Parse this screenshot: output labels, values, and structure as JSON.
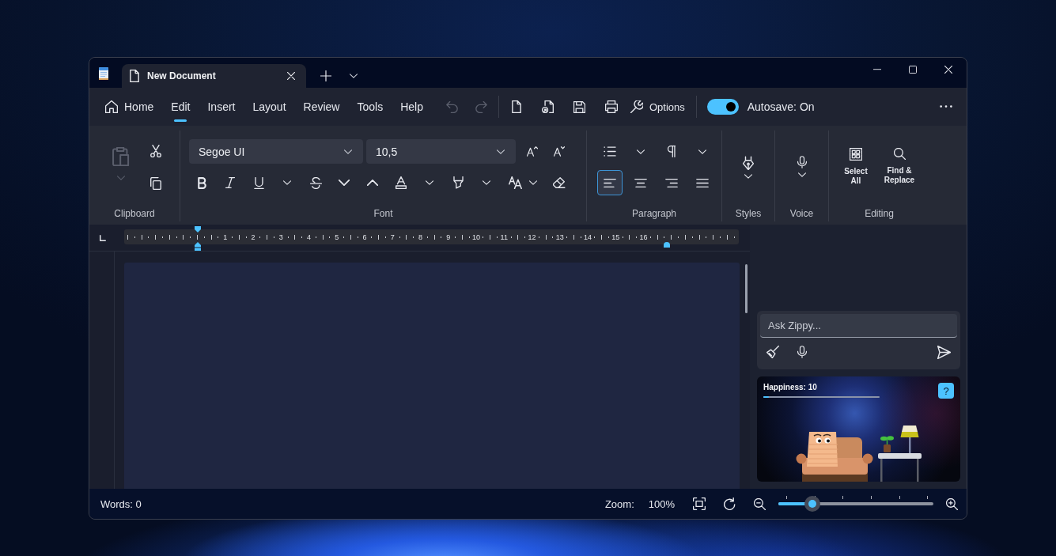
{
  "title_bar": {
    "tabs": [
      {
        "label": "New Document",
        "selected": true
      }
    ]
  },
  "menu_bar": {
    "items": [
      {
        "label": "Home",
        "kind": "home",
        "selected": false
      },
      {
        "label": "Edit",
        "kind": "plain",
        "selected": true
      },
      {
        "label": "Insert",
        "kind": "plain",
        "selected": false
      },
      {
        "label": "Layout",
        "kind": "plain",
        "selected": false
      },
      {
        "label": "Review",
        "kind": "plain",
        "selected": false
      },
      {
        "label": "Tools",
        "kind": "plain",
        "selected": false
      },
      {
        "label": "Help",
        "kind": "plain",
        "selected": false
      }
    ],
    "undo": {
      "disabled": true
    },
    "redo": {
      "disabled": true
    },
    "options": {
      "label": "Options"
    },
    "autosave": {
      "label": "Autosave: On",
      "on": true
    }
  },
  "ribbon": {
    "clipboard": {
      "label": "Clipboard",
      "paste": {
        "disabled": true
      }
    },
    "font": {
      "label": "Font",
      "font_name": "Segoe UI",
      "font_size": "10,5"
    },
    "paragraph": {
      "label": "Paragraph",
      "alignments": [
        {
          "kind": "left",
          "selected": true
        },
        {
          "kind": "center",
          "selected": false
        },
        {
          "kind": "right",
          "selected": false
        },
        {
          "kind": "justify",
          "selected": false
        }
      ]
    },
    "styles": {
      "label": "Styles"
    },
    "voice": {
      "label": "Voice"
    },
    "editing": {
      "label": "Editing",
      "buttons": [
        {
          "kind": "select_all",
          "label": "Select All"
        },
        {
          "kind": "find_replace",
          "label": "Find & Replace"
        }
      ]
    }
  },
  "ruler": {
    "numbers": [
      "1",
      "2",
      "3",
      "4",
      "5",
      "6",
      "7",
      "8",
      "9",
      "10",
      "11",
      "12",
      "13",
      "14",
      "15",
      "16"
    ]
  },
  "assistant": {
    "input": {
      "placeholder": "Ask Zippy..."
    },
    "pet": {
      "happiness": {
        "label": "Happiness: 10",
        "level": 0.05
      },
      "help_button": "?"
    }
  },
  "status_bar": {
    "words": "Words: 0",
    "zoom_label": "Zoom:",
    "zoom_value": "100%",
    "zoom_slider": {
      "level": 0.22
    }
  }
}
